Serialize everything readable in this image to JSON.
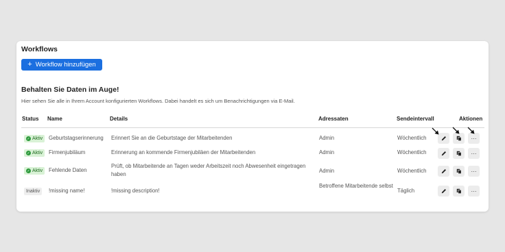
{
  "page": {
    "title": "Workflows",
    "add_button": {
      "label": "Workflow hinzufügen",
      "icon": "plus-icon"
    },
    "section_title": "Behalten Sie Daten im Auge!",
    "section_desc": "Hier sehen Sie alle in Ihrem Account konfigurierten Workflows. Dabei handelt es sich um Benachrichtigungen via E-Mail."
  },
  "table": {
    "headers": {
      "status": "Status",
      "name": "Name",
      "details": "Details",
      "recipients": "Adressaten",
      "interval": "Sendeintervall",
      "actions": "Aktionen"
    },
    "rows": [
      {
        "status": "Aktiv",
        "name": "Geburtstagserinnerung",
        "details": "Erinnert Sie an die Geburtstage der Mitarbeitenden",
        "recipients": "Admin",
        "interval": "Wöchentlich"
      },
      {
        "status": "Aktiv",
        "name": "Firmenjubiläum",
        "details": "Erinnerung an kommende Firmenjubiläen der Mitarbeitenden",
        "recipients": "Admin",
        "interval": "Wöchentlich"
      },
      {
        "status": "Aktiv",
        "name": "Fehlende Daten",
        "details": "Prüft, ob Mitarbeitende an Tagen weder Arbeitszeit noch Abwesenheit eingetragen haben",
        "recipients": "Admin",
        "interval": "Wöchentlich"
      },
      {
        "status": "Inaktiv",
        "name": "!missing name!",
        "details": "!missing description!",
        "recipients": "Betroffene Mitarbeitende selbst",
        "interval": "Täglich"
      }
    ],
    "actions": {
      "edit_icon": "pencil-icon",
      "copy_icon": "copy-icon",
      "more_icon": "more-icon",
      "more_glyph": "···"
    }
  },
  "colors": {
    "background": "#e6e6e6",
    "accent": "#1b6fe0",
    "active_badge_bg": "#d9f2d6",
    "active_badge_text": "#1e6a1e",
    "inactive_badge_bg": "#eeeeee"
  }
}
